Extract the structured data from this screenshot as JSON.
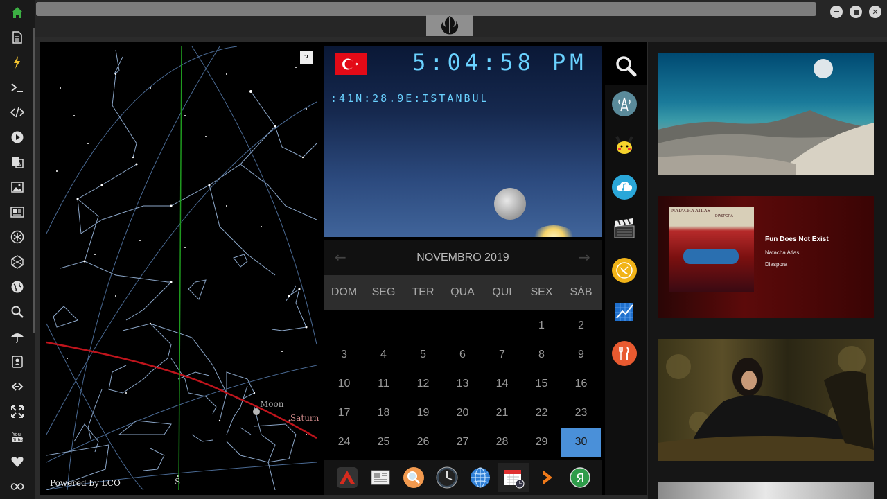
{
  "sidebar": {
    "items": [
      {
        "name": "home-icon"
      },
      {
        "name": "document-icon"
      },
      {
        "name": "lightning-icon"
      },
      {
        "name": "terminal-icon"
      },
      {
        "name": "code-icon"
      },
      {
        "name": "play-icon"
      },
      {
        "name": "translate-icon"
      },
      {
        "name": "image-icon"
      },
      {
        "name": "news-icon"
      },
      {
        "name": "asterisk-icon"
      },
      {
        "name": "hexagon-icon"
      },
      {
        "name": "globe-icon"
      },
      {
        "name": "search-icon"
      },
      {
        "name": "umbrella-icon"
      },
      {
        "name": "contacts-icon"
      },
      {
        "name": "link-icon"
      },
      {
        "name": "expand-icon"
      },
      {
        "name": "youtube-icon"
      },
      {
        "name": "heart-icon"
      },
      {
        "name": "infinity-icon"
      }
    ]
  },
  "window": {
    "logo": "rebel-alliance-icon",
    "controls": [
      "minimize-icon",
      "maximize-icon",
      "close-icon"
    ]
  },
  "skymap": {
    "help_label": "?",
    "powered_by": "Powered by LCO",
    "moon_label": "Moon",
    "saturn_label": "Saturn",
    "south_label": "S",
    "colors": {
      "ecliptic": "#c0141c",
      "meridian": "#1f9a1f",
      "constellation": "#8ba6c8"
    }
  },
  "clock": {
    "time": "5:04:58",
    "ampm": "PM",
    "location": ":41N:28.9E:ISTANBUL",
    "flag": "turkey-flag"
  },
  "calendar": {
    "title": "NOVEMBRO 2019",
    "prev_icon": "arrow-left-icon",
    "next_icon": "arrow-right-icon",
    "weekdays": [
      "DOM",
      "SEG",
      "TER",
      "QUA",
      "QUI",
      "SEX",
      "SÁB"
    ],
    "weeks": [
      [
        "",
        "",
        "",
        "",
        "",
        "1",
        "2"
      ],
      [
        "3",
        "4",
        "5",
        "6",
        "7",
        "8",
        "9"
      ],
      [
        "10",
        "11",
        "12",
        "13",
        "14",
        "15",
        "16"
      ],
      [
        "17",
        "18",
        "19",
        "20",
        "21",
        "22",
        "23"
      ],
      [
        "24",
        "25",
        "26",
        "27",
        "28",
        "29",
        "30"
      ]
    ],
    "today": "30",
    "today_color": "#4a90d9"
  },
  "dock": {
    "items": [
      "app-launcher-icon",
      "news-reader-icon",
      "search-app-icon",
      "clock-app-icon",
      "browser-globe-icon",
      "calendar-app-icon",
      "arrow-app-icon",
      "yandex-icon"
    ]
  },
  "apps": {
    "search": "magnifier-icon",
    "items": [
      "radio-tower-icon",
      "pikachu-icon",
      "cloud-music-icon",
      "clapperboard-icon",
      "satellite-dish-icon",
      "chart-icon",
      "restaurant-icon"
    ]
  },
  "media": {
    "album_artist": "NATACHA ATLAS",
    "album_cover_title": "DIASPORA",
    "song_title": "Fun Does Not Exist",
    "artist": "Natacha Atlas",
    "album": "Diaspora"
  }
}
